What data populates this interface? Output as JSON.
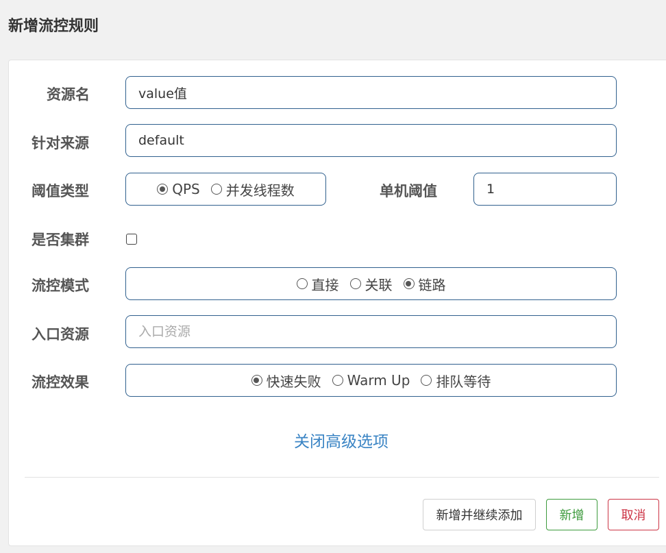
{
  "dialog": {
    "title": "新增流控规则"
  },
  "form": {
    "resource": {
      "label": "资源名",
      "value": "value值"
    },
    "source": {
      "label": "针对来源",
      "value": "default"
    },
    "threshold_type": {
      "label": "阈值类型",
      "options": [
        "QPS",
        "并发线程数"
      ],
      "selected": "QPS"
    },
    "single_threshold": {
      "label": "单机阈值",
      "value": "1"
    },
    "cluster": {
      "label": "是否集群",
      "checked": false
    },
    "mode": {
      "label": "流控模式",
      "options": [
        "直接",
        "关联",
        "链路"
      ],
      "selected": "链路"
    },
    "entry_resource": {
      "label": "入口资源",
      "value": "",
      "placeholder": "入口资源"
    },
    "effect": {
      "label": "流控效果",
      "options": [
        "快速失败",
        "Warm Up",
        "排队等待"
      ],
      "selected": "快速失败"
    },
    "advanced_toggle": "关闭高级选项"
  },
  "footer": {
    "add_continue_label": "新增并继续添加",
    "add_label": "新增",
    "cancel_label": "取消"
  },
  "colors": {
    "field_border": "#2f5f8d",
    "link": "#3a84c4",
    "add_button": "#3c9a3c",
    "cancel_button": "#cc3344"
  }
}
